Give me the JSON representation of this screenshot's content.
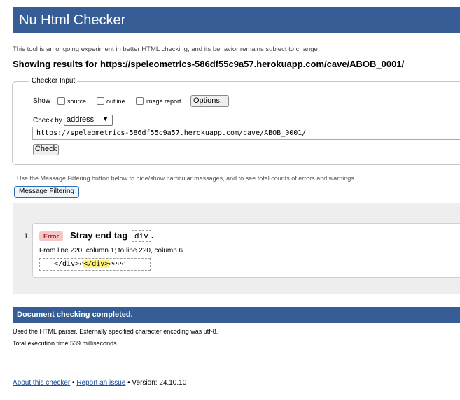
{
  "header": {
    "title": "Nu Html Checker"
  },
  "intro": "This tool is an ongoing experiment in better HTML checking, and its behavior remains subject to change",
  "showing": "Showing results for https://speleometrics-586df55c9a57.herokuapp.com/cave/ABOB_0001/",
  "checker_input": {
    "legend": "Checker Input",
    "show_label": "Show",
    "options": [
      {
        "label": "source",
        "checked": false
      },
      {
        "label": "outline",
        "checked": false
      },
      {
        "label": "image report",
        "checked": false
      }
    ],
    "options_button": "Options...",
    "check_by_label": "Check by",
    "check_by_value": "address",
    "url_value": "https://speleometrics-586df55c9a57.herokuapp.com/cave/ABOB_0001/",
    "check_button": "Check"
  },
  "filtering": {
    "text": "Use the Message Filtering button below to hide/show particular messages, and to see total counts of errors and warnings.",
    "button": "Message Filtering"
  },
  "messages": [
    {
      "number": "1.",
      "type": "Error",
      "title": "Stray end tag",
      "tag": "div",
      "title_end": ".",
      "location": "From line 220, column 1; to line 220, column 6",
      "extract_before": "</div>↩",
      "extract_highlight": "</div>",
      "extract_after": "↩↩↩↩"
    }
  ],
  "done": "Document checking completed.",
  "parser_info": "Used the HTML parser. Externally specified character encoding was utf-8.",
  "time_info": "Total execution time 539 milliseconds.",
  "footer": {
    "about_link": "About this checker",
    "sep1": " • ",
    "report_link": "Report an issue",
    "version": " • Version: 24.10.10"
  },
  "colors": {
    "header_bg": "#365d95",
    "error_badge_bg": "#f5c6c6",
    "highlight": "#fff27a"
  }
}
